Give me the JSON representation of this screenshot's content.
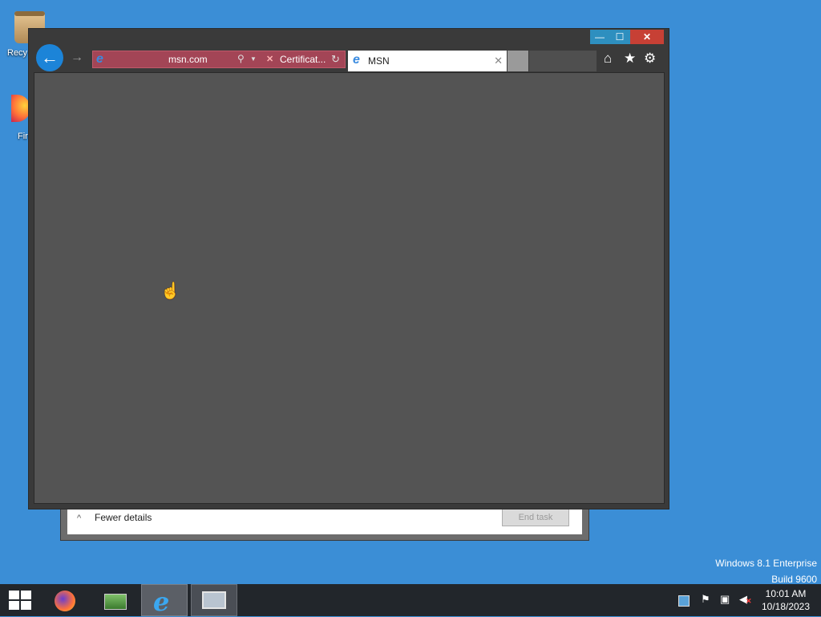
{
  "desktop": {
    "icons": [
      {
        "label": "Recy"
      },
      {
        "label": "Fir"
      }
    ]
  },
  "task_manager": {
    "chevron": "^",
    "fewer_details": "Fewer details",
    "end_task": "End task"
  },
  "ie": {
    "caption": {
      "minimize": "—",
      "maximize": "☐",
      "close": "✕"
    },
    "back_glyph": "←",
    "forward_glyph": "→",
    "address": {
      "url": "msn.com",
      "search_glyph": "⚲",
      "dropdown_glyph": "▼",
      "cert_error_glyph": "✕",
      "cert_label": "Certificat...",
      "refresh_glyph": "↻"
    },
    "tabs": [
      {
        "title": "MSN",
        "close_glyph": "✕"
      }
    ],
    "tools": {
      "home": "⌂",
      "favorites": "★",
      "settings": "⚙"
    }
  },
  "cursor_glyph": "☝",
  "watermark": {
    "line1": "Windows 8.1 Enterprise",
    "line2": "Build 9600"
  },
  "taskbar": {
    "apps": [
      "firefox",
      "photos",
      "internet-explorer",
      "resource-monitor"
    ],
    "ie_glyph": "e",
    "tray": {
      "flag": "⚑",
      "network": "▣",
      "volume": "◀",
      "volume_mute": "✕"
    },
    "clock": {
      "time": "10:01 AM",
      "date": "10/18/2023"
    }
  }
}
